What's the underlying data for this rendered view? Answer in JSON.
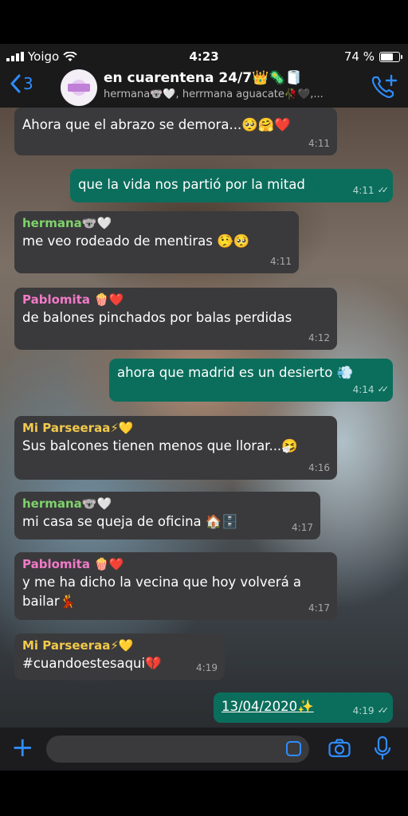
{
  "status_bar": {
    "carrier": "Yoigo",
    "time": "4:23",
    "battery": "74 %",
    "battery_level": 0.74
  },
  "header": {
    "back_count": "3",
    "title": "en cuarentena 24/7👑🦠🧻",
    "subtitle": "hermana🐨🤍, herrmana aguacate🥀🖤,..."
  },
  "messages": [
    {
      "dir": "in",
      "sender": "",
      "text": "Ahora que el abrazo se demora...🥺🤗❤️",
      "time": "4:11"
    },
    {
      "dir": "out",
      "text": "que la vida nos partió por la mitad",
      "time": "4:11"
    },
    {
      "dir": "in",
      "sender": "hermana🐨🤍",
      "text": "me veo rodeado de mentiras 🤥🥺",
      "time": "4:11"
    },
    {
      "dir": "in",
      "sender": "Pablomita 🍿❤️",
      "text": "de balones pinchados por balas perdidas",
      "time": "4:12"
    },
    {
      "dir": "out",
      "text": "ahora que madrid es un desierto 💨",
      "time": "4:14"
    },
    {
      "dir": "in",
      "sender": "Mi Parseeraa⚡💛",
      "text": "Sus balcones tienen menos que llorar...🤧",
      "time": "4:16"
    },
    {
      "dir": "in",
      "sender": "hermana🐨🤍",
      "text": "mi casa se queja de oficina 🏠🗄️",
      "time": "4:17"
    },
    {
      "dir": "in",
      "sender": "Pablomita 🍿❤️",
      "text": "y me ha dicho la vecina que hoy volverá a bailar💃",
      "time": "4:17"
    },
    {
      "dir": "in",
      "sender": "Mi Parseeraa⚡💛",
      "text": "#cuandoestesaqui💔",
      "time": "4:19"
    },
    {
      "dir": "out",
      "text": "13/04/2020✨",
      "time": "4:19"
    }
  ],
  "colors": {
    "accent": "#2f8cff",
    "outgoing": "#0b6e5c",
    "incoming": "#3a3a3c",
    "sender_green": "#7fd26b",
    "sender_pink": "#f27ac8",
    "sender_yellow": "#f2c94c"
  },
  "icons": {
    "back": "chevron-left-icon",
    "call": "add-call-icon",
    "attach": "plus-icon",
    "sticker": "sticker-icon",
    "camera": "camera-icon",
    "mic": "microphone-icon"
  }
}
